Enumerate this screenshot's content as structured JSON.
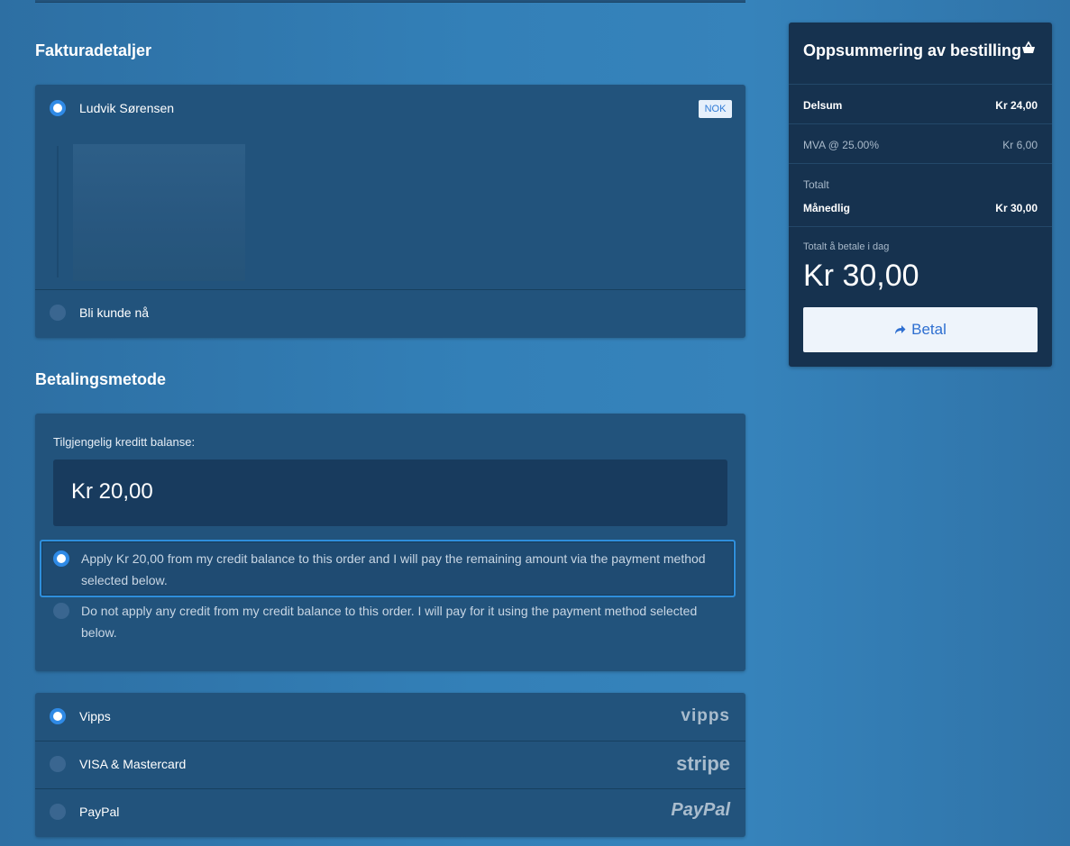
{
  "billing": {
    "title": "Fakturadetaljer",
    "account_name": "Ludvik Sørensen",
    "currency_badge": "NOK",
    "new_customer_label": "Bli kunde nå"
  },
  "payment": {
    "title": "Betalingsmetode",
    "credit_label": "Tilgjengelig kreditt balanse:",
    "credit_amount": "Kr 20,00",
    "apply_option": "Apply Kr 20,00 from my credit balance to this order and I will pay the remaining amount via the payment method selected below.",
    "no_apply_option": "Do not apply any credit from my credit balance to this order. I will pay for it using the payment method selected below.",
    "methods": [
      {
        "label": "Vipps",
        "brand": "vipps",
        "selected": true
      },
      {
        "label": "VISA & Mastercard",
        "brand": "stripe",
        "selected": false
      },
      {
        "label": "PayPal",
        "brand": "PayPal",
        "selected": false
      }
    ]
  },
  "summary": {
    "title": "Oppsummering av bestilling",
    "subtotal_label": "Delsum",
    "subtotal_value": "Kr 24,00",
    "vat_label": "MVA @ 25.00%",
    "vat_value": "Kr 6,00",
    "total_label": "Totalt",
    "monthly_label": "Månedlig",
    "monthly_value": "Kr 30,00",
    "due_today_label": "Totalt å betale i dag",
    "due_today_value": "Kr 30,00",
    "pay_button": "Betal"
  },
  "colors": {
    "accent": "#2f8ae6",
    "card_bg": "#22537c",
    "summary_bg": "#16324f",
    "button_text": "#2e6fd1"
  }
}
